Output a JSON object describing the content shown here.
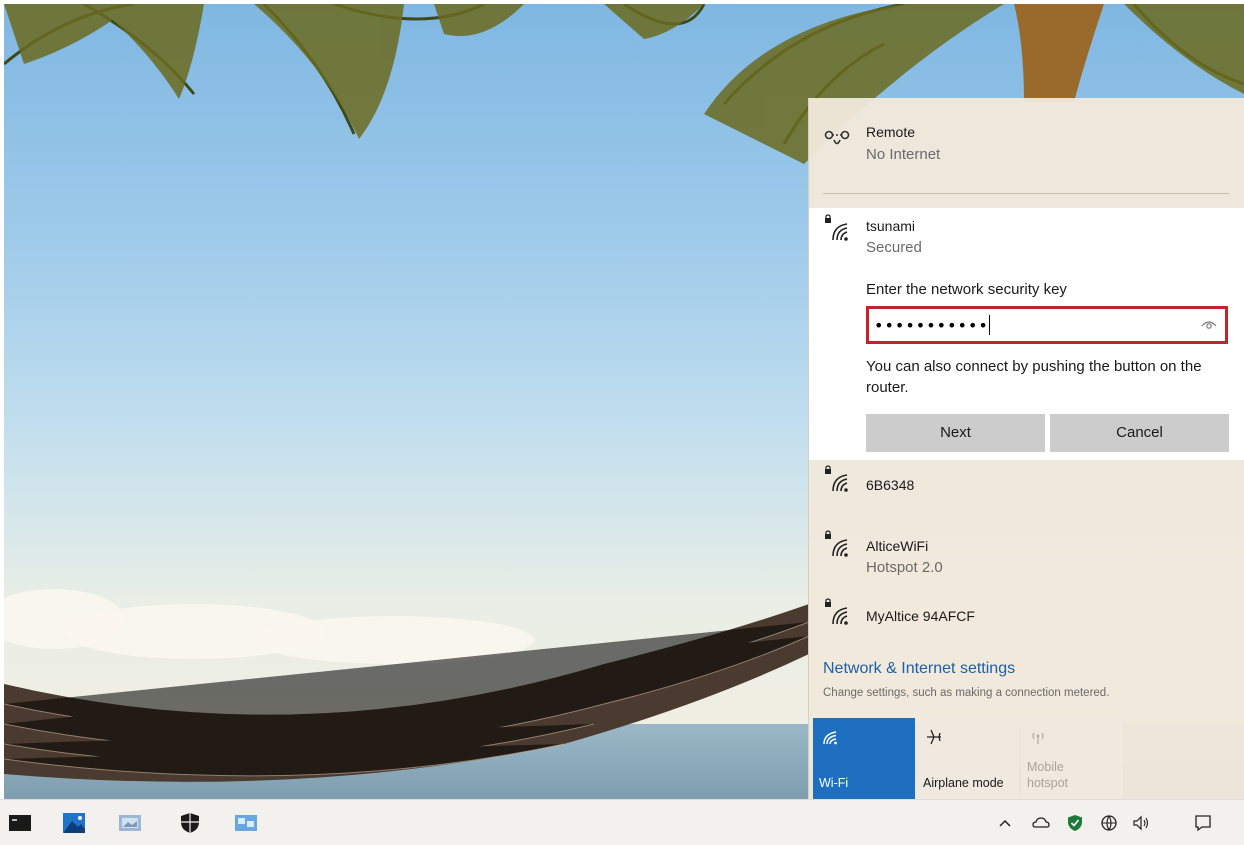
{
  "flyout": {
    "networks": [
      {
        "name": "Remote",
        "status": "No Internet"
      },
      {
        "name": "tsunami",
        "status": "Secured"
      },
      {
        "name": "6B6348",
        "status": ""
      },
      {
        "name": "AlticeWiFi",
        "status": "Hotspot 2.0"
      },
      {
        "name": "MyAltice 94AFCF",
        "status": ""
      }
    ],
    "security_prompt": "Enter the network security key",
    "password_value": "•••••••••••",
    "hint": "You can also connect by pushing the button on the router.",
    "next_label": "Next",
    "cancel_label": "Cancel",
    "settings_link": "Network & Internet settings",
    "settings_sub": "Change settings, such as making a connection metered.",
    "tiles": {
      "wifi": "Wi-Fi",
      "airplane": "Airplane mode",
      "hotspot": "Mobile hotspot"
    }
  },
  "taskbar": {
    "apps": [
      "terminal-icon",
      "photos-icon",
      "image-viewer-icon",
      "security-shield-icon",
      "remote-desktop-icon"
    ],
    "tray": [
      "chevron-up-icon",
      "onedrive-icon",
      "defender-icon",
      "network-icon",
      "volume-icon",
      "notification-icon"
    ]
  },
  "colors": {
    "accent": "#1e6fc0",
    "highlight_border": "#c4232c",
    "link": "#1d5fa8"
  }
}
